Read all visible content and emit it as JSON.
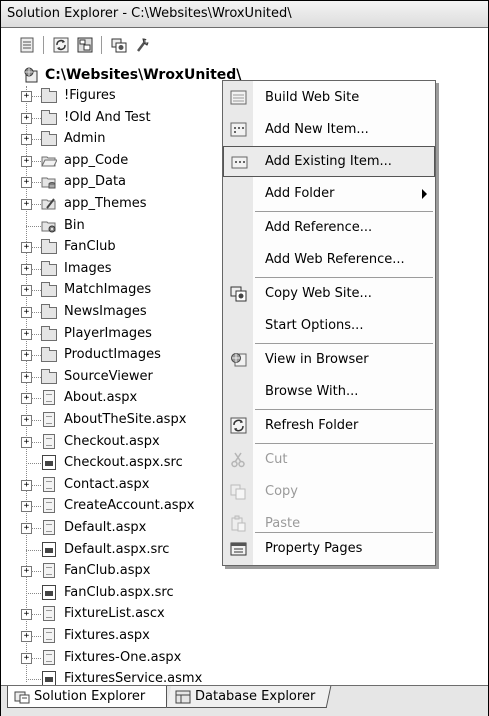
{
  "window": {
    "title": "Solution Explorer - C:\\Websites\\WroxUnited\\"
  },
  "toolbar": {
    "icons": [
      "properties-icon",
      "refresh-icon",
      "nest-related-files-icon",
      "copy-web-site-icon",
      "asp-net-configuration-icon"
    ]
  },
  "tree": {
    "root": {
      "label": "C:\\Websites\\WroxUnited\\"
    },
    "items": [
      {
        "label": "!Figures",
        "icon": "folder",
        "expander": true
      },
      {
        "label": "!Old And Test",
        "icon": "folder",
        "expander": true
      },
      {
        "label": "Admin",
        "icon": "folder",
        "expander": true
      },
      {
        "label": "app_Code",
        "icon": "open-folder",
        "expander": true
      },
      {
        "label": "app_Data",
        "icon": "data-folder",
        "expander": true
      },
      {
        "label": "app_Themes",
        "icon": "themes-folder",
        "expander": true
      },
      {
        "label": "Bin",
        "icon": "bin-folder",
        "expander": false
      },
      {
        "label": "FanClub",
        "icon": "folder",
        "expander": true
      },
      {
        "label": "Images",
        "icon": "folder",
        "expander": true
      },
      {
        "label": "MatchImages",
        "icon": "folder",
        "expander": true
      },
      {
        "label": "NewsImages",
        "icon": "folder",
        "expander": true
      },
      {
        "label": "PlayerImages",
        "icon": "folder",
        "expander": true
      },
      {
        "label": "ProductImages",
        "icon": "folder",
        "expander": true
      },
      {
        "label": "SourceViewer",
        "icon": "folder",
        "expander": true
      },
      {
        "label": "About.aspx",
        "icon": "page",
        "expander": true
      },
      {
        "label": "AboutTheSite.aspx",
        "icon": "page",
        "expander": true
      },
      {
        "label": "Checkout.aspx",
        "icon": "page",
        "expander": true
      },
      {
        "label": "Checkout.aspx.src",
        "icon": "code",
        "expander": false
      },
      {
        "label": "Contact.aspx",
        "icon": "page",
        "expander": true
      },
      {
        "label": "CreateAccount.aspx",
        "icon": "page",
        "expander": true
      },
      {
        "label": "Default.aspx",
        "icon": "page",
        "expander": true
      },
      {
        "label": "Default.aspx.src",
        "icon": "code",
        "expander": false
      },
      {
        "label": "FanClub.aspx",
        "icon": "page",
        "expander": true
      },
      {
        "label": "FanClub.aspx.src",
        "icon": "code",
        "expander": false
      },
      {
        "label": "FixtureList.ascx",
        "icon": "page",
        "expander": true
      },
      {
        "label": "Fixtures.aspx",
        "icon": "page",
        "expander": true
      },
      {
        "label": "Fixtures-One.aspx",
        "icon": "page",
        "expander": true
      },
      {
        "label": "FixturesService.asmx",
        "icon": "code",
        "expander": false
      }
    ]
  },
  "context_menu": {
    "items": {
      "build_web_site": "Build Web Site",
      "add_new_item": "Add New Item...",
      "add_existing_item": "Add Existing Item...",
      "add_folder": "Add Folder",
      "add_reference": "Add Reference...",
      "add_web_reference": "Add Web Reference...",
      "copy_web_site": "Copy Web Site...",
      "start_options": "Start Options...",
      "view_in_browser": "View in Browser",
      "browse_with": "Browse With...",
      "refresh_folder": "Refresh Folder",
      "cut": "Cut",
      "copy": "Copy",
      "paste": "Paste",
      "property_pages": "Property Pages"
    },
    "highlighted": "Add Existing Item...",
    "disabled": [
      "Cut",
      "Copy",
      "Paste"
    ]
  },
  "tabs": {
    "solution_explorer": "Solution Explorer",
    "database_explorer": "Database Explorer",
    "active": "Solution Explorer"
  }
}
